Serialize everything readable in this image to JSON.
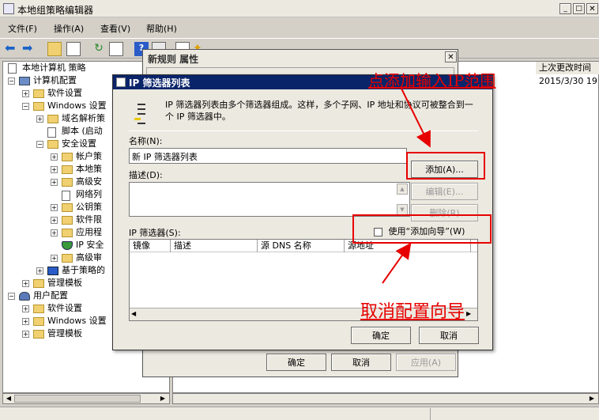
{
  "window": {
    "title": "本地组策略编辑器"
  },
  "menu": [
    "文件(F)",
    "操作(A)",
    "查看(V)",
    "帮助(H)"
  ],
  "tree": {
    "root": "本地计算机 策略",
    "items": [
      {
        "label": "计算机配置",
        "level": 1,
        "exp": "-",
        "icon": "computer"
      },
      {
        "label": "软件设置",
        "level": 2,
        "exp": "+",
        "icon": "folder"
      },
      {
        "label": "Windows 设置",
        "level": 2,
        "exp": "-",
        "icon": "folder"
      },
      {
        "label": "域名解析策",
        "level": 3,
        "exp": "+",
        "icon": "folder"
      },
      {
        "label": "脚本 (启动",
        "level": 3,
        "exp": "",
        "icon": "doc"
      },
      {
        "label": "安全设置",
        "level": 3,
        "exp": "-",
        "icon": "folder"
      },
      {
        "label": "帐户策",
        "level": 4,
        "exp": "+",
        "icon": "folder"
      },
      {
        "label": "本地策",
        "level": 4,
        "exp": "+",
        "icon": "folder"
      },
      {
        "label": "高级安",
        "level": 4,
        "exp": "+",
        "icon": "folder"
      },
      {
        "label": "网络列",
        "level": 4,
        "exp": "",
        "icon": "doc"
      },
      {
        "label": "公钥策",
        "level": 4,
        "exp": "+",
        "icon": "folder"
      },
      {
        "label": "软件限",
        "level": 4,
        "exp": "+",
        "icon": "folder"
      },
      {
        "label": "应用程",
        "level": 4,
        "exp": "+",
        "icon": "folder"
      },
      {
        "label": "IP 安全",
        "level": 4,
        "exp": "",
        "icon": "shield"
      },
      {
        "label": "高级审",
        "level": 4,
        "exp": "+",
        "icon": "folder"
      },
      {
        "label": "基于策略的",
        "level": 3,
        "exp": "+",
        "icon": "chart"
      },
      {
        "label": "管理模板",
        "level": 2,
        "exp": "+",
        "icon": "folder"
      },
      {
        "label": "用户配置",
        "level": 1,
        "exp": "-",
        "icon": "user"
      },
      {
        "label": "软件设置",
        "level": 2,
        "exp": "+",
        "icon": "folder"
      },
      {
        "label": "Windows 设置",
        "level": 2,
        "exp": "+",
        "icon": "folder"
      },
      {
        "label": "管理模板",
        "level": 2,
        "exp": "+",
        "icon": "folder"
      }
    ]
  },
  "right_panel": {
    "header_modified": "上次更改时间",
    "row_date": "2015/3/30 19"
  },
  "rule_dialog": {
    "title": "新规则 属性",
    "ok": "确定",
    "cancel": "取消",
    "apply": "应用(A)"
  },
  "ip_dialog": {
    "title": "IP 筛选器列表",
    "description": "IP 筛选器列表由多个筛选器组成。这样，多个子网、IP 地址和协议可被整合到一个 IP 筛选器中。",
    "name_label": "名称(N):",
    "name_value": "新 IP 筛选器列表",
    "desc_label": "描述(D):",
    "add": "添加(A)...",
    "edit": "编辑(E)...",
    "remove": "删除(R)",
    "filters_label": "IP 筛选器(S):",
    "wizard_label": "使用“添加向导”(W)",
    "columns": [
      "镜像",
      "描述",
      "源 DNS 名称",
      "源地址"
    ],
    "ok": "确定",
    "cancel": "取消"
  },
  "annotations": {
    "top": "点添加输入IP范围",
    "bottom": "取消配置向导"
  },
  "colors": {
    "accent_red": "#e60000",
    "title_blue": "#0a246a"
  }
}
